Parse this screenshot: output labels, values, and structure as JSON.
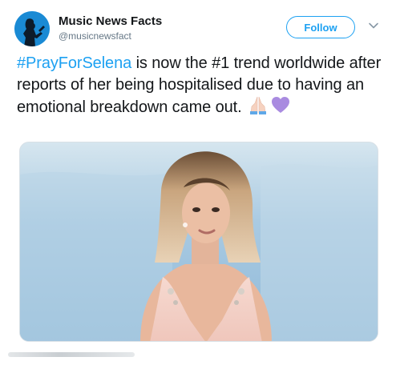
{
  "tweet": {
    "author": {
      "display_name": "Music News Facts",
      "handle": "@musicnewsfact",
      "avatar_icon": "silhouette-avatar-icon"
    },
    "follow_label": "Follow",
    "text": {
      "hashtag": "#PrayForSelena",
      "body": " is now the #1 trend worldwide after reports of her being hospitalised due to having an emotional breakdown came out. ",
      "emojis": [
        "praying-hands-icon",
        "purple-heart-icon"
      ]
    },
    "media": {
      "type": "photo"
    }
  },
  "colors": {
    "accent": "#1da1f2",
    "text": "#14171a",
    "muted": "#657786",
    "heart": "#a98be0"
  }
}
